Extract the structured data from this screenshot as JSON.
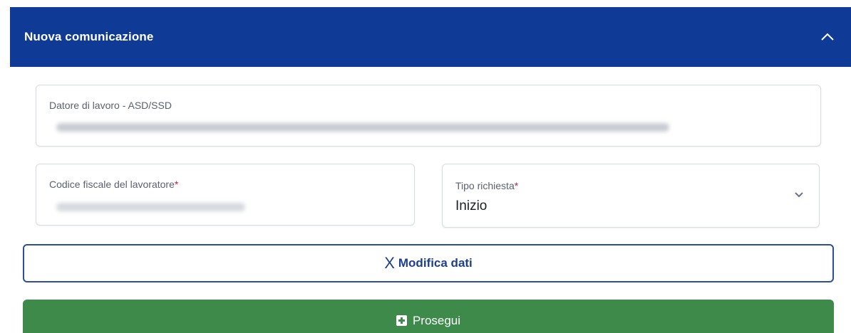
{
  "header": {
    "title": "Nuova comunicazione",
    "collapse_icon": "chevron-up-icon"
  },
  "employer": {
    "label": "Datore di lavoro - ASD/SSD"
  },
  "worker_tax_code": {
    "label": "Codice fiscale del lavoratore",
    "required_mark": "*"
  },
  "request_type": {
    "label": "Tipo richiesta",
    "required_mark": "*",
    "selected_value": "Inizio",
    "icon": "chevron-down-icon"
  },
  "edit_button": {
    "icon_glyph": "X",
    "label": "Modifica dati"
  },
  "continue_button": {
    "icon": "plus-square-icon",
    "label": "Prosegui"
  },
  "colors": {
    "header_bg": "#0f3a95",
    "primary_outline": "#2b4f9e",
    "success": "#3e8a4a",
    "required": "#c4203a"
  }
}
